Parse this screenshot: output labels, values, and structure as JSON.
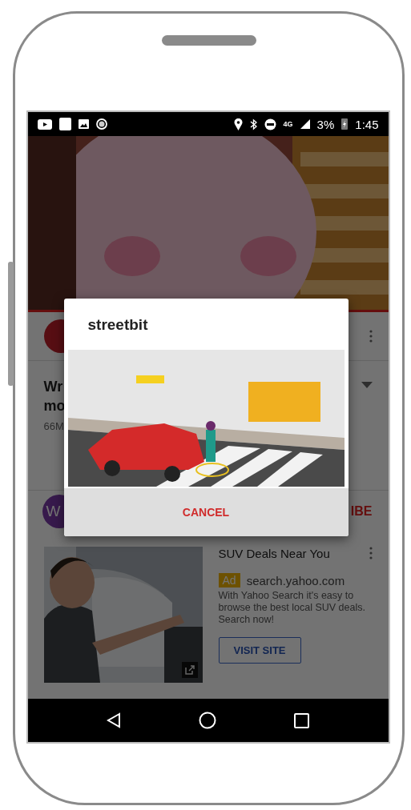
{
  "status_bar": {
    "network": "4G",
    "battery": "3%",
    "time": "1:45"
  },
  "video_page": {
    "title_lines": [
      "Wr",
      "mo"
    ],
    "views": "66M",
    "channel_initial": "W",
    "subscribe": "IBE"
  },
  "ad": {
    "title": "SUV Deals Near You",
    "badge": "Ad",
    "domain": "search.yahoo.com",
    "description": "With Yahoo Search it's easy to browse the best local SUV deals. Search now!",
    "button": "VISIT SITE"
  },
  "dialog": {
    "title": "streetbit",
    "button": "CANCEL"
  }
}
